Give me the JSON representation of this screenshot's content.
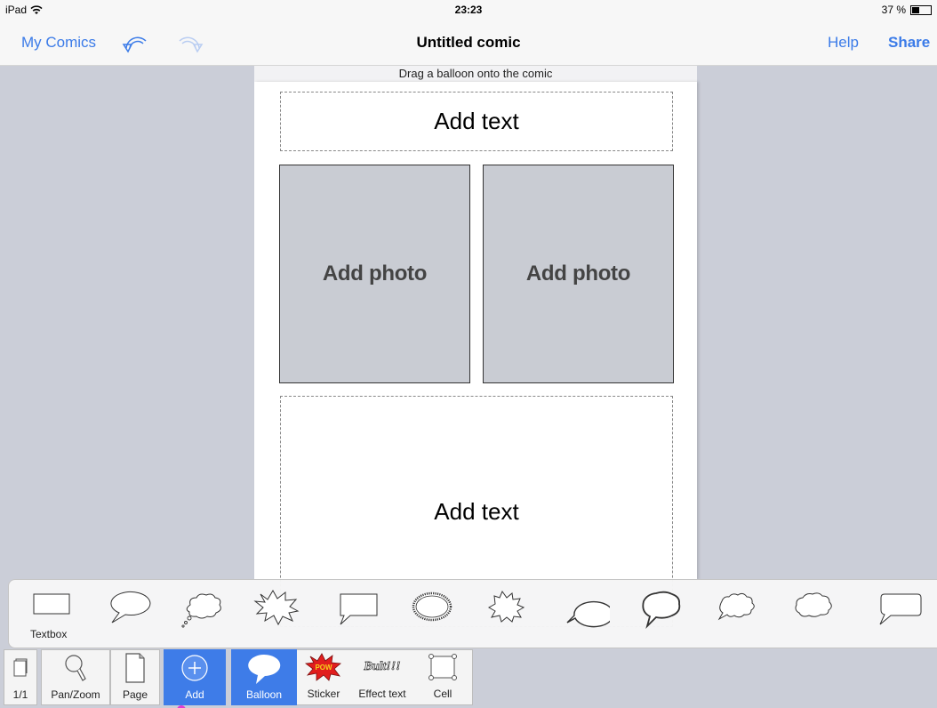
{
  "status_bar": {
    "device": "iPad",
    "time": "23:23",
    "battery": "37 %"
  },
  "navbar": {
    "back_label": "My Comics",
    "title": "Untitled comic",
    "help_label": "Help",
    "share_label": "Share"
  },
  "hint": "Drag a balloon onto the comic",
  "comic": {
    "top_text": "Add text",
    "photo_left": "Add photo",
    "photo_right": "Add photo",
    "bottom_text": "Add text"
  },
  "tray": {
    "textbox_label": "Textbox",
    "items": [
      "textbox",
      "oval-speech",
      "thought-cloud",
      "spiky-burst",
      "rectangle-speech",
      "jagged-oval",
      "star-burst",
      "oval-plain",
      "wavy-oval",
      "cloud-small",
      "cloud-medium",
      "rounded-rect-speech"
    ]
  },
  "toolbar": {
    "page_count": "1/1",
    "panzoom": "Pan/Zoom",
    "page": "Page",
    "add": "Add",
    "balloon": "Balloon",
    "sticker": "Sticker",
    "sticker_text": "POW",
    "effect_text": "Effect text",
    "effect_icon_text": "Bult!!!",
    "cell": "Cell"
  },
  "colors": {
    "accent": "#3e7ce8",
    "link": "#3b7be8",
    "workspace": "#cbced8",
    "photo_placeholder": "#c9ccd3"
  }
}
